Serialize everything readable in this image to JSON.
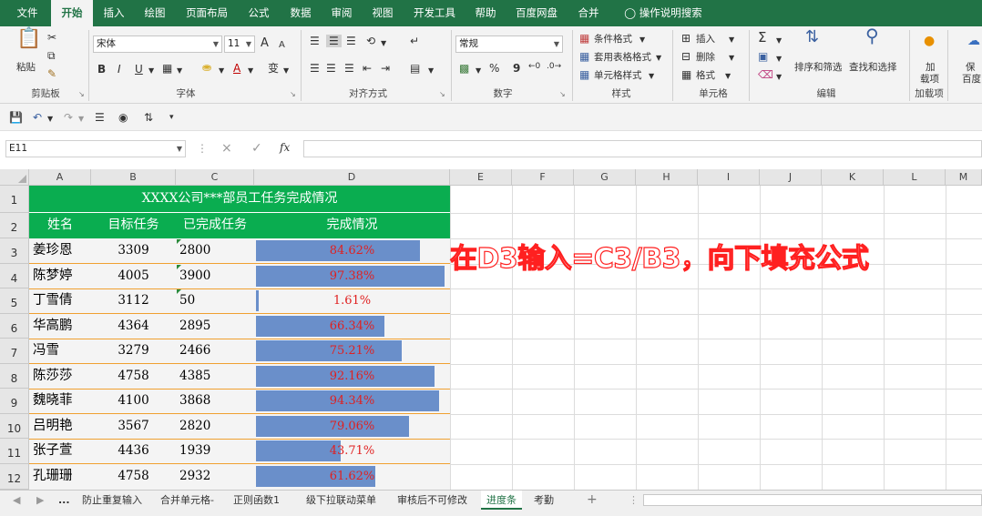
{
  "menu": {
    "tabs": [
      "文件",
      "开始",
      "插入",
      "绘图",
      "页面布局",
      "公式",
      "数据",
      "审阅",
      "视图",
      "开发工具",
      "帮助",
      "百度网盘",
      "合并"
    ],
    "active_tab": "开始",
    "tell_me": "操作说明搜索"
  },
  "ribbon": {
    "clipboard": {
      "paste": "粘贴",
      "group": "剪贴板"
    },
    "font": {
      "name": "宋体",
      "size": "11",
      "bold": "B",
      "italic": "I",
      "underline": "U",
      "grow": "A",
      "shrink": "A",
      "font_color": "A",
      "phonetic": "变",
      "group": "字体"
    },
    "alignment": {
      "group": "对齐方式"
    },
    "number": {
      "format": "常规",
      "percent": "%",
      "comma": "9",
      "group": "数字"
    },
    "styles": {
      "conditional": "条件格式",
      "table": "套用表格格式",
      "cell": "单元格样式",
      "group": "样式"
    },
    "cells": {
      "insert": "插入",
      "delete": "删除",
      "format": "格式",
      "group": "单元格"
    },
    "editing": {
      "sum": "Σ",
      "sort": "排序和筛选",
      "find": "查找和选择",
      "group": "编辑"
    },
    "addins": {
      "label1": "加",
      "label2": "载项",
      "group": "加载项"
    },
    "extra": {
      "label1": "保",
      "label2": "百度"
    }
  },
  "formula_bar": {
    "name_box": "E11",
    "cancel": "×",
    "enter": "✓",
    "fx": "fx",
    "formula": ""
  },
  "columns": [
    "A",
    "B",
    "C",
    "D",
    "E",
    "F",
    "G",
    "H",
    "I",
    "J",
    "K",
    "L",
    "M"
  ],
  "rows": [
    "1",
    "2",
    "3",
    "4",
    "5",
    "6",
    "7",
    "8",
    "9",
    "10",
    "11",
    "12"
  ],
  "sheet": {
    "title": "XXXX公司***部员工任务完成情况",
    "headers": [
      "姓名",
      "目标任务",
      "已完成任务",
      "完成情况"
    ],
    "data": [
      {
        "name": "姜珍恩",
        "target": "3309",
        "done": "2800",
        "pct": "84.62%",
        "ratio": 0.8462
      },
      {
        "name": "陈梦婷",
        "target": "4005",
        "done": "3900",
        "pct": "97.38%",
        "ratio": 0.9738
      },
      {
        "name": "丁雪倩",
        "target": "3112",
        "done": "50",
        "pct": "1.61%",
        "ratio": 0.0161
      },
      {
        "name": "华高鹏",
        "target": "4364",
        "done": "2895",
        "pct": "66.34%",
        "ratio": 0.6634
      },
      {
        "name": "冯雪",
        "target": "3279",
        "done": "2466",
        "pct": "75.21%",
        "ratio": 0.7521
      },
      {
        "name": "陈莎莎",
        "target": "4758",
        "done": "4385",
        "pct": "92.16%",
        "ratio": 0.9216
      },
      {
        "name": "魏晓菲",
        "target": "4100",
        "done": "3868",
        "pct": "94.34%",
        "ratio": 0.9434
      },
      {
        "name": "吕明艳",
        "target": "3567",
        "done": "2820",
        "pct": "79.06%",
        "ratio": 0.7906
      },
      {
        "name": "张子萱",
        "target": "4436",
        "done": "1939",
        "pct": "43.71%",
        "ratio": 0.4371
      },
      {
        "name": "孔珊珊",
        "target": "4758",
        "done": "2932",
        "pct": "61.62%",
        "ratio": 0.6162
      }
    ]
  },
  "annotation": "在D3输入=C3/B3，向下填充公式",
  "sheet_tabs": {
    "more": "...",
    "items": [
      "防止重复输入",
      "合并单元格-",
      "正则函数1",
      "级下拉联动菜单",
      "审核后不可修改",
      "进度条",
      "考勤"
    ],
    "active": "进度条",
    "add": "+"
  },
  "colors": {
    "excel_green": "#217346",
    "title_fill": "#0aad50",
    "bar": "#6a8fca",
    "percent_text": "#e02020",
    "annotation": "#ff2020"
  }
}
